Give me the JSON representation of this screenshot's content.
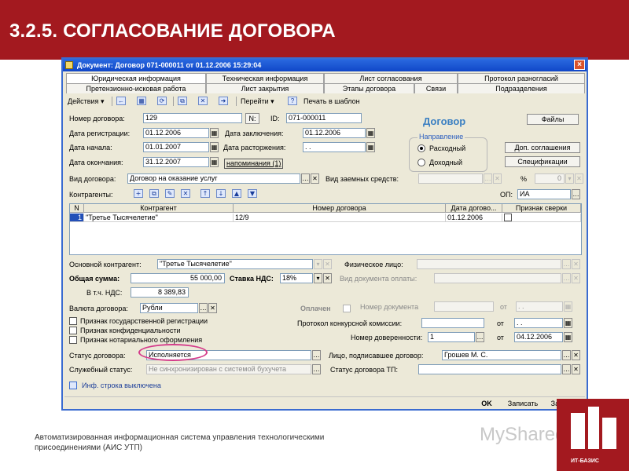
{
  "slide": {
    "title": "3.2.5. СОГЛАСОВАНИЕ ДОГОВОРА",
    "footer": "Автоматизированная информационная система управления технологическими присоединениями (АИС УТП)",
    "watermark": "MyShared",
    "logo_text": "ИТ-БАЗИС"
  },
  "window": {
    "title": "Документ: Договор 071-000011 от 01.12.2006 15:29:04",
    "tabs_row1": [
      "Юридическая информация",
      "Техническая информация",
      "Лист согласования",
      "Протокол разногласий"
    ],
    "tabs_row2": [
      "Претензионно-исковая работа",
      "Лист закрытия",
      "Этапы договора",
      "Связи",
      "Подразделения"
    ],
    "toolbar": {
      "actions": "Действия",
      "goto": "Перейти",
      "print": "Печать в шаблон"
    },
    "header_label": "Договор",
    "form": {
      "contract_number_label": "Номер договора:",
      "contract_number": "129",
      "number_btn": "N:",
      "id_label": "ID:",
      "id_value": "071-000011",
      "reg_date_label": "Дата регистрации:",
      "reg_date": "01.12.2006",
      "conclusion_date_label": "Дата заключения:",
      "conclusion_date": "01.12.2006",
      "start_date_label": "Дата начала:",
      "start_date": "01.01.2007",
      "termination_date_label": "Дата расторжения:",
      "termination_date": " .  .",
      "end_date_label": "Дата окончания:",
      "end_date": "31.12.2007",
      "reminders": "напоминания (1)",
      "direction_label": "Направление",
      "direction_options": [
        "Расходный",
        "Доходный"
      ],
      "files_btn": "Файлы",
      "addl_agreements_btn": "Доп. соглашения",
      "specs_btn": "Спецификации",
      "contract_type_label": "Вид договора:",
      "contract_type": "Договор на оказание услуг",
      "borrowed_funds_label": "Вид заемных средств:",
      "percent_label": "%",
      "percent_value": "0",
      "counterparties_label": "Контрагенты:",
      "op_label": "ОП:",
      "op_value": "ИА"
    },
    "grid": {
      "columns": [
        "N",
        "Контрагент",
        "Номер договора",
        "Дата догово...",
        "Признак сверки"
      ],
      "rows": [
        [
          "1",
          "\"Третье Тысячелетие\"",
          "12/9",
          "01.12.2006",
          ""
        ]
      ]
    },
    "lower": {
      "main_counterparty_label": "Основной контрагент:",
      "main_counterparty": "\"Третье Тысячелетие\"",
      "individual_label": "Физическое лицо:",
      "total_label": "Общая сумма:",
      "total": "55 000,00",
      "vat_rate_label": "Ставка НДС:",
      "vat_rate": "18%",
      "payment_doc_type_label": "Вид документа оплаты:",
      "incl_vat_label": "В т.ч. НДС:",
      "incl_vat": "8 389,83",
      "currency_label": "Валюта договора:",
      "currency": "Рубли",
      "paid_label": "Оплачен",
      "doc_number_label": "Номер документа",
      "from_label": "от",
      "date_blank": " .  .",
      "checks": [
        "Признак государственной регистрации",
        "Признак конфиденциальности",
        "Признак нотариального оформления"
      ],
      "tender_protocol_label": "Протокол конкурсной комиссии:",
      "poa_number_label": "Номер доверенности:",
      "poa_number": "1",
      "poa_date": "04.12.2006",
      "status_label": "Статус договора:",
      "status": "Исполняется",
      "signer_label": "Лицо, подписавшее договор:",
      "signer": "Грошев М. С.",
      "service_status_label": "Служебный статус:",
      "service_status": "Не синхронизирован с системой бухучета",
      "tp_status_label": "Статус договора ТП:",
      "info_line": "Инф. строка выключена"
    },
    "buttons": {
      "ok": "OK",
      "save": "Записать",
      "close": "Закрыть"
    }
  },
  "colors": {
    "title_bar": "#a3191f",
    "window_title": "#1f5bd6",
    "window_bg": "#ece9d8",
    "highlight_oval": "#d43a8a"
  }
}
